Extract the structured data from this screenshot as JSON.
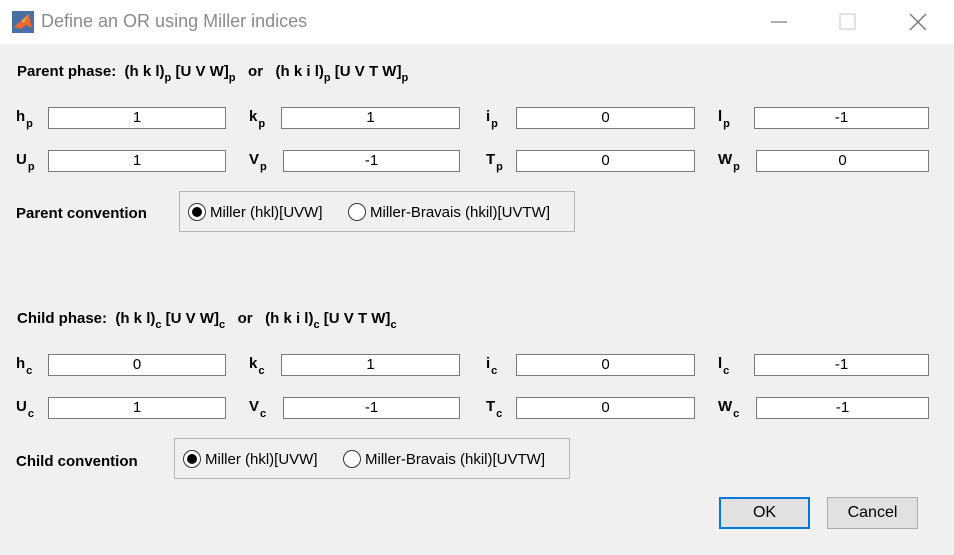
{
  "window": {
    "title": "Define an OR using Miller indices",
    "controls": {
      "minimize": "minimize-icon",
      "maximize": "maximize-icon",
      "close": "close-icon"
    }
  },
  "parent": {
    "header": {
      "label": "Parent phase:",
      "miller": "(h k l)",
      "miller_dir": "[U V W]",
      "or": "or",
      "bravais": "(h k i l)",
      "bravais_dir": "[U V T W]",
      "sub": "p"
    },
    "fields": {
      "h": {
        "label": "h",
        "sub": "p",
        "value": "1"
      },
      "k": {
        "label": "k",
        "sub": "p",
        "value": "1"
      },
      "i": {
        "label": "i",
        "sub": "p",
        "value": "0"
      },
      "l": {
        "label": "l",
        "sub": "p",
        "value": "-1"
      },
      "U": {
        "label": "U",
        "sub": "p",
        "value": "1"
      },
      "V": {
        "label": "V",
        "sub": "p",
        "value": "-1"
      },
      "T": {
        "label": "T",
        "sub": "p",
        "value": "0"
      },
      "W": {
        "label": "W",
        "sub": "p",
        "value": "0"
      }
    },
    "convention": {
      "label": "Parent convention",
      "options": [
        "Miller (hkl)[UVW]",
        "Miller-Bravais (hkil)[UVTW]"
      ],
      "selected": "Miller (hkl)[UVW]"
    }
  },
  "child": {
    "header": {
      "label": "Child phase:",
      "miller": "(h k l)",
      "miller_dir": "[U V W]",
      "or": "or",
      "bravais": "(h k i l)",
      "bravais_dir": "[U V T W]",
      "sub": "c"
    },
    "fields": {
      "h": {
        "label": "h",
        "sub": "c",
        "value": "0"
      },
      "k": {
        "label": "k",
        "sub": "c",
        "value": "1"
      },
      "i": {
        "label": "i",
        "sub": "c",
        "value": "0"
      },
      "l": {
        "label": "l",
        "sub": "c",
        "value": "-1"
      },
      "U": {
        "label": "U",
        "sub": "c",
        "value": "1"
      },
      "V": {
        "label": "V",
        "sub": "c",
        "value": "-1"
      },
      "T": {
        "label": "T",
        "sub": "c",
        "value": "0"
      },
      "W": {
        "label": "W",
        "sub": "c",
        "value": "-1"
      }
    },
    "convention": {
      "label": "Child convention",
      "options": [
        "Miller (hkl)[UVW]",
        "Miller-Bravais (hkil)[UVTW]"
      ],
      "selected": "Miller (hkl)[UVW]"
    }
  },
  "buttons": {
    "ok": "OK",
    "cancel": "Cancel"
  },
  "colors": {
    "background": "#f0f0f0",
    "titlebar": "#ffffff",
    "accent": "#0078d7"
  }
}
